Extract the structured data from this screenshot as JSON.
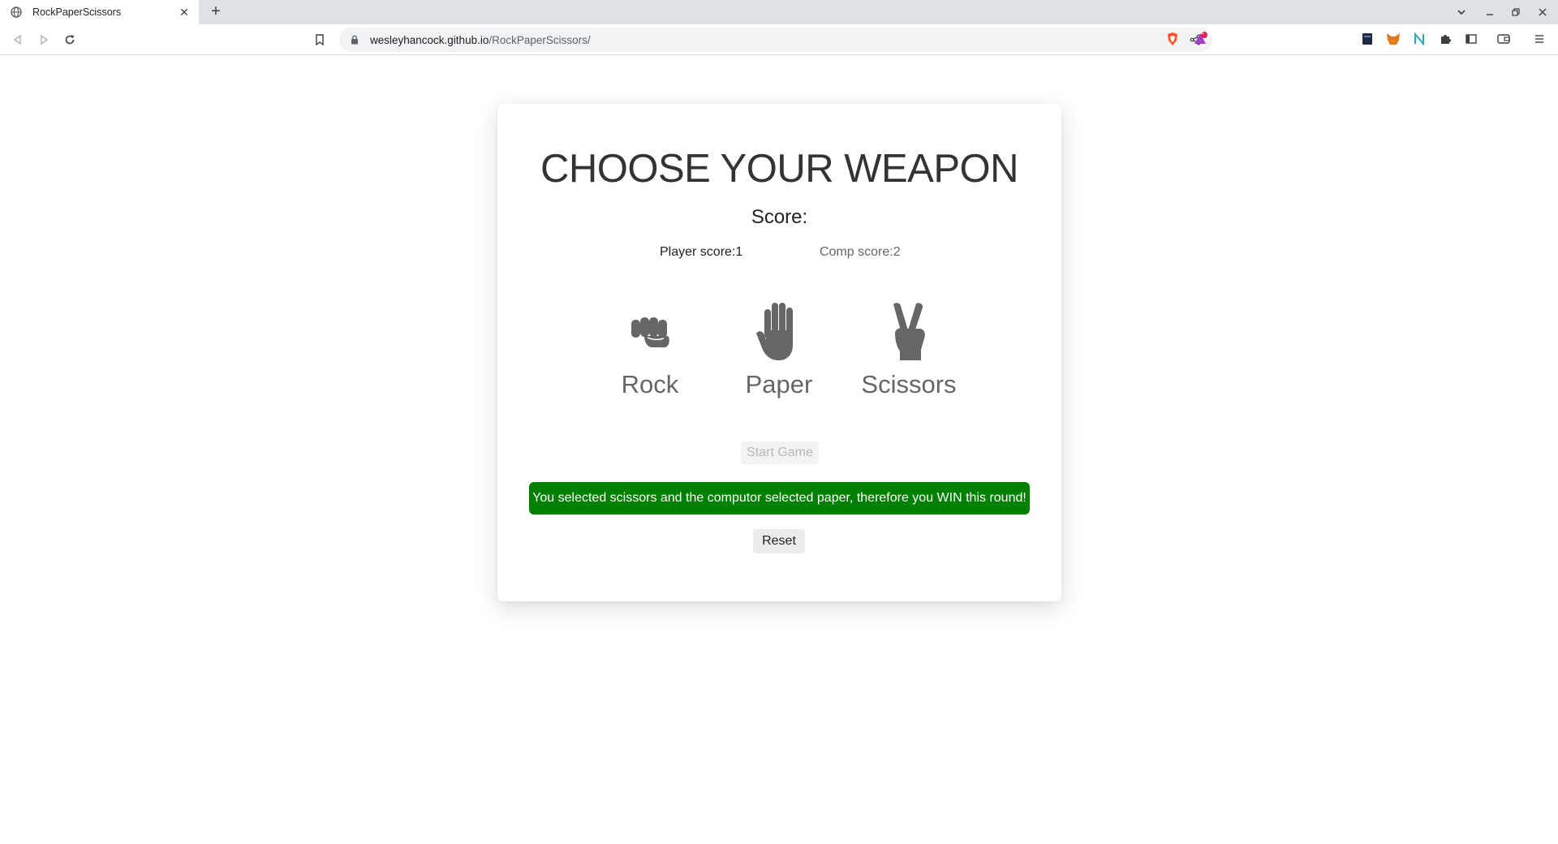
{
  "browser": {
    "tab_title": "RockPaperScissors",
    "url_host": "wesleyhancock.github.io",
    "url_path": "/RockPaperScissors/",
    "shields_badge": "1"
  },
  "game": {
    "heading": "CHOOSE YOUR WEAPON",
    "score_title": "Score:",
    "player_score": "Player score:1",
    "comp_score": "Comp score:2",
    "weapons": [
      {
        "label": "Rock",
        "icon": "fist-icon"
      },
      {
        "label": "Paper",
        "icon": "hand-paper-icon"
      },
      {
        "label": "Scissors",
        "icon": "peace-sign-icon"
      }
    ],
    "start_button": "Start Game",
    "result_message": "You selected scissors and the computor selected paper, therefore you WIN this round!",
    "reset_button": "Reset"
  },
  "colors": {
    "result_background": "#008000",
    "icon_gray": "#666666",
    "heading_text": "#333333"
  }
}
